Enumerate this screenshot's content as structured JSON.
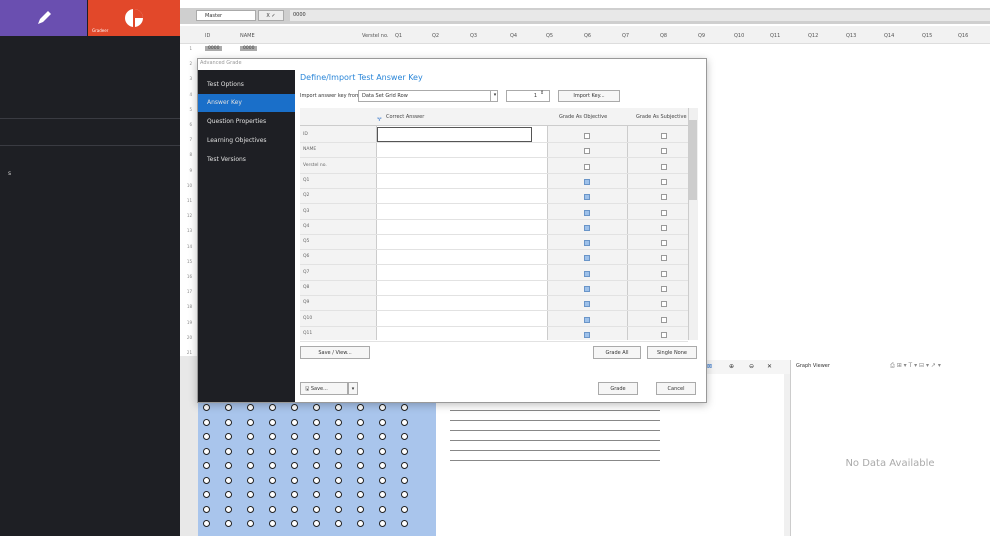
{
  "toolbar": {
    "edit_label": "",
    "grade_label": "Gradeer"
  },
  "grid": {
    "cell_ref": "Master",
    "fx": "X ✓",
    "formula_value": "0000",
    "columns": [
      "ID",
      "NAME",
      "Verstel no.",
      "Q1",
      "Q2",
      "Q3",
      "Q4",
      "Q5",
      "Q6",
      "Q7",
      "Q8",
      "Q9",
      "Q10",
      "Q11",
      "Q12",
      "Q13",
      "Q14",
      "Q15",
      "Q16"
    ],
    "first_row": [
      "0000",
      "0000"
    ]
  },
  "dialog": {
    "title": "Advanced Grade",
    "heading": "Define/Import Test Answer Key",
    "nav": [
      "Test Options",
      "Answer Key",
      "Question Properties",
      "Learning Objectives",
      "Test Versions"
    ],
    "import_label": "Import answer key from:",
    "import_source": "Data Set Grid Row",
    "spin_value": "1",
    "import_button": "Import Key...",
    "columns": [
      "Correct Answer",
      "Grade As Objective",
      "Grade As Subjective"
    ],
    "rows": [
      "ID",
      "NAME",
      "Verstel no.",
      "Q1",
      "Q2",
      "Q3",
      "Q4",
      "Q5",
      "Q6",
      "Q7",
      "Q8",
      "Q9",
      "Q10",
      "Q11"
    ],
    "save_view_button": "Save / View...",
    "grade_all_button": "Grade All",
    "single_none_button": "Single None",
    "save_button": "Save...",
    "grade_button": "Grade",
    "cancel_button": "Cancel"
  },
  "viewer": {
    "graph_title": "Graph Viewer",
    "no_data": "No Data Available"
  }
}
